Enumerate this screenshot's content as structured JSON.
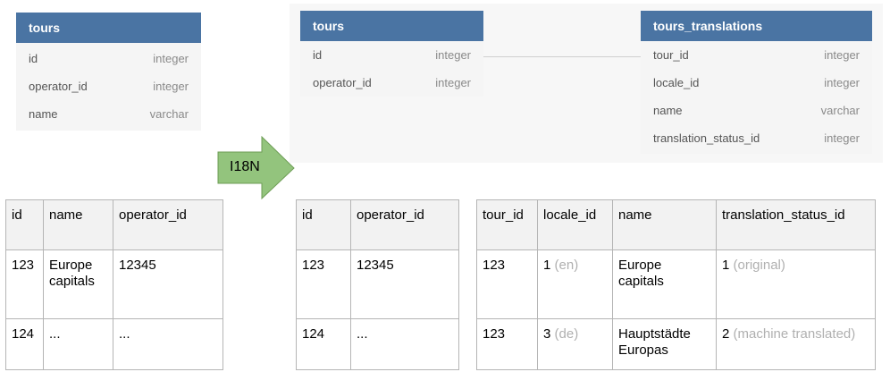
{
  "left_entity": {
    "title": "tours",
    "fields": [
      {
        "name": "id",
        "type": "integer"
      },
      {
        "name": "operator_id",
        "type": "integer"
      },
      {
        "name": "name",
        "type": "varchar"
      }
    ]
  },
  "arrow": {
    "label": "I18N",
    "fill": "#93c47d",
    "stroke": "#6d9d55"
  },
  "right_tours_entity": {
    "title": "tours",
    "fields": [
      {
        "name": "id",
        "type": "integer"
      },
      {
        "name": "operator_id",
        "type": "integer"
      }
    ]
  },
  "translations_entity": {
    "title": "tours_translations",
    "fields": [
      {
        "name": "tour_id",
        "type": "integer"
      },
      {
        "name": "locale_id",
        "type": "integer"
      },
      {
        "name": "name",
        "type": "varchar"
      },
      {
        "name": "translation_status_id",
        "type": "integer"
      }
    ]
  },
  "table_original": {
    "headers": [
      "id",
      "name",
      "operator_id"
    ],
    "rows": [
      [
        "123",
        "Europe capitals",
        "12345"
      ],
      [
        "124",
        "...",
        "..."
      ]
    ]
  },
  "table_tours": {
    "headers": [
      "id",
      "operator_id"
    ],
    "rows": [
      [
        "123",
        "12345"
      ],
      [
        "124",
        "..."
      ]
    ]
  },
  "table_translations": {
    "headers": [
      "tour_id",
      "locale_id",
      "name",
      "translation_status_id"
    ],
    "rows": [
      [
        {
          "main": "123",
          "note": ""
        },
        {
          "main": "1",
          "note": "(en)"
        },
        {
          "main": "Europe capitals",
          "note": ""
        },
        {
          "main": "1",
          "note": "(original)"
        }
      ],
      [
        {
          "main": "123",
          "note": ""
        },
        {
          "main": "3",
          "note": "(de)"
        },
        {
          "main": "Hauptstädte Europas",
          "note": ""
        },
        {
          "main": "2",
          "note": "(machine translated)"
        }
      ]
    ]
  },
  "colors": {
    "header": "#4a74a3",
    "row_bg": "#f5f5f5",
    "muted": "#b0b0b0"
  }
}
